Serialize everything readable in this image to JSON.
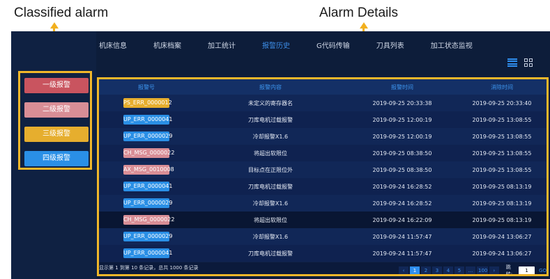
{
  "annotations": {
    "classified": "Classified alarm",
    "details": "Alarm Details"
  },
  "colors": {
    "annotation": "#f2b01e",
    "level1": "#c9545f",
    "level2": "#d98e96",
    "level3": "#e6ae2e",
    "level4": "#2a8fe6"
  },
  "nav": {
    "items": [
      {
        "label": "机床信息"
      },
      {
        "label": "机床档案"
      },
      {
        "label": "加工统计"
      },
      {
        "label": "报警历史"
      },
      {
        "label": "G代码传输"
      },
      {
        "label": "刀具列表"
      },
      {
        "label": "加工状态监视"
      }
    ],
    "active": "报警历史"
  },
  "view_icons": [
    "list-view-icon",
    "grid-view-icon"
  ],
  "alarm_levels": [
    {
      "label": "一级报警",
      "color": "#c9545f"
    },
    {
      "label": "二级报警",
      "color": "#d98e96"
    },
    {
      "label": "三级报警",
      "color": "#e6ae2e"
    },
    {
      "label": "四级报警",
      "color": "#2a8fe6"
    }
  ],
  "table": {
    "headers": [
      "报警号",
      "报警内容",
      "报警时间",
      "消除时间"
    ],
    "rows": [
      {
        "code": "PS_ERR_0000012",
        "content": "未定义的寄存器名",
        "time": "2019-09-25 20:33:38",
        "cleared": "2019-09-25 20:33:40",
        "level": 3
      },
      {
        "code": "UP_ERR_0000041",
        "content": "刀库电机过载报警",
        "time": "2019-09-25 12:00:19",
        "cleared": "2019-09-25 13:08:55",
        "level": 4
      },
      {
        "code": "UP_ERR_0000029",
        "content": "冷却报警X1.6",
        "time": "2019-09-25 12:00:19",
        "cleared": "2019-09-25 13:08:55",
        "level": 4
      },
      {
        "code": "CH_MSG_0000022",
        "content": "将超出软限位",
        "time": "2019-09-25 08:38:50",
        "cleared": "2019-09-25 13:08:55",
        "level": 2
      },
      {
        "code": "AX_MSG_0010008",
        "content": "目标点在正限位外",
        "time": "2019-09-25 08:38:50",
        "cleared": "2019-09-25 13:08:55",
        "level": 2
      },
      {
        "code": "UP_ERR_0000041",
        "content": "刀库电机过载报警",
        "time": "2019-09-24 16:28:52",
        "cleared": "2019-09-25 08:13:19",
        "level": 4
      },
      {
        "code": "UP_ERR_0000029",
        "content": "冷却报警X1.6",
        "time": "2019-09-24 16:28:52",
        "cleared": "2019-09-25 08:13:19",
        "level": 4
      },
      {
        "code": "CH_MSG_0000022",
        "content": "将超出软限位",
        "time": "2019-09-24 16:22:09",
        "cleared": "2019-09-25 08:13:19",
        "level": 2
      },
      {
        "code": "UP_ERR_0000029",
        "content": "冷却报警X1.6",
        "time": "2019-09-24 11:57:47",
        "cleared": "2019-09-24 13:06:27",
        "level": 4
      },
      {
        "code": "UP_ERR_0000041",
        "content": "刀库电机过载报警",
        "time": "2019-09-24 11:57:47",
        "cleared": "2019-09-24 13:06:27",
        "level": 4
      }
    ]
  },
  "footer": {
    "summary": "显示第 1 到第 10 条记录，总共 1000 条记录",
    "pager": {
      "prev": "‹",
      "pages": [
        "1",
        "2",
        "3",
        "4",
        "5",
        "...",
        "100"
      ],
      "next": "›",
      "current": "1",
      "jump_label": "跳转:",
      "jump_value": "1",
      "go_label": "GO"
    }
  }
}
